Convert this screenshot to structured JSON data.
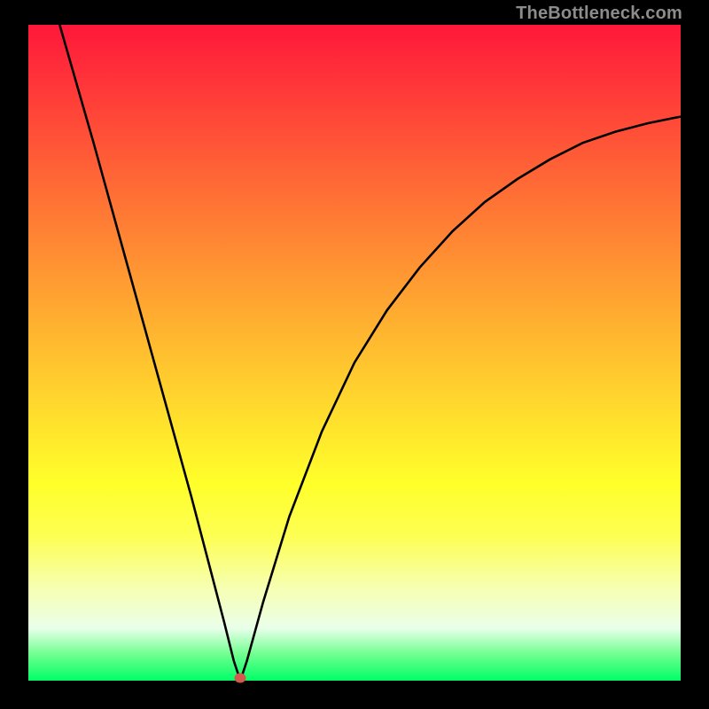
{
  "watermark": "TheBottleneck.com",
  "colors": {
    "frame": "#000000",
    "curve_stroke": "#000000",
    "marker": "#d3584e"
  },
  "chart_data": {
    "type": "line",
    "title": "",
    "xlabel": "",
    "ylabel": "",
    "xlim": [
      0,
      1
    ],
    "ylim": [
      0,
      1
    ],
    "grid": false,
    "marker": {
      "x": 0.325,
      "y": 0.0
    },
    "series": [
      {
        "name": "left-branch",
        "x": [
          0.048,
          0.1,
          0.15,
          0.2,
          0.25,
          0.3,
          0.315,
          0.325
        ],
        "y": [
          1.0,
          0.82,
          0.64,
          0.46,
          0.28,
          0.09,
          0.03,
          0.0
        ]
      },
      {
        "name": "right-branch",
        "x": [
          0.325,
          0.335,
          0.36,
          0.4,
          0.45,
          0.5,
          0.55,
          0.6,
          0.65,
          0.7,
          0.75,
          0.8,
          0.85,
          0.9,
          0.95,
          1.0
        ],
        "y": [
          0.0,
          0.03,
          0.12,
          0.25,
          0.38,
          0.485,
          0.565,
          0.63,
          0.685,
          0.73,
          0.765,
          0.795,
          0.82,
          0.837,
          0.85,
          0.86
        ]
      }
    ]
  }
}
